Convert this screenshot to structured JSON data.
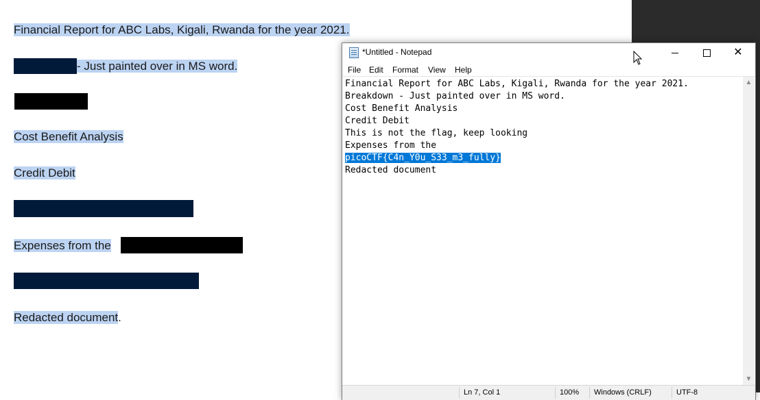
{
  "document": {
    "lines": [
      "Financial Report for ABC Labs, Kigali, Rwanda for the year 2021.",
      " - Just painted over in MS word.",
      "Cost Benefit Analysis",
      "Credit Debit",
      "Expenses from the ",
      "Redacted document",
      "."
    ]
  },
  "notepad": {
    "title": "*Untitled - Notepad",
    "menu": [
      "File",
      "Edit",
      "Format",
      "View",
      "Help"
    ],
    "content": [
      "Financial Report for ABC Labs, Kigali, Rwanda for the year 2021.",
      "Breakdown - Just painted over in MS word.",
      "Cost Benefit Analysis",
      "Credit Debit",
      "This is not the flag, keep looking",
      "Expenses from the",
      "picoCTF{C4n_Y0u_S33_m3_fully}",
      "Redacted document"
    ],
    "status": {
      "position": "Ln 7, Col 1",
      "zoom": "100%",
      "line_ending": "Windows (CRLF)",
      "encoding": "UTF-8"
    }
  },
  "colors": {
    "highlight": "#bcd3f2",
    "redaction_navy": "#011a3a",
    "redaction_black": "#000000",
    "selection": "#0078d7"
  },
  "icons": [
    "notepad-icon",
    "minimize-icon",
    "maximize-icon",
    "close-icon",
    "scroll-up-icon",
    "scroll-down-icon",
    "mouse-pointer-icon"
  ]
}
